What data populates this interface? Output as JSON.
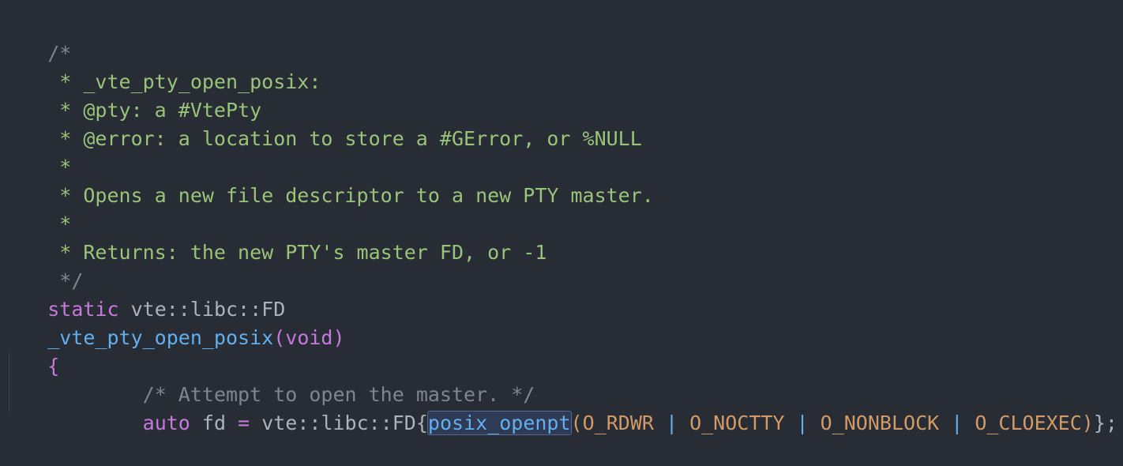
{
  "colors": {
    "background": "#282c34",
    "doc_comment": "#98c379",
    "dim_comment": "#7f848e",
    "keyword": "#c678dd",
    "function": "#61afef",
    "constant": "#d19a66",
    "plain": "#abb2bf",
    "selection": "#2f3b54"
  },
  "code": {
    "l1": {
      "a": "/*"
    },
    "l2": {
      "a": " * _vte_pty_open_posix:"
    },
    "l3": {
      "a": " * @pty: a #VtePty"
    },
    "l4": {
      "a": " * @error: a location to store a #GError, or %NULL"
    },
    "l5": {
      "a": " *"
    },
    "l6": {
      "a": " * Opens a new file descriptor to a new PTY master."
    },
    "l7": {
      "a": " *"
    },
    "l8": {
      "a": " * Returns: the new PTY's master FD, or -1"
    },
    "l9": {
      "a": " */"
    },
    "l10": {
      "kw": "static",
      "sp": " ",
      "type": "vte::libc::FD"
    },
    "l11": {
      "fn": "_vte_pty_open_posix",
      "lp": "(",
      "arg": "void",
      "rp": ")"
    },
    "l12": {
      "brace": "{"
    },
    "l13": {
      "indent": "        ",
      "comment": "/* Attempt to open the master. */"
    },
    "l14": {
      "indent": "        ",
      "kw": "auto",
      "var": " fd ",
      "eq": "=",
      "ns": " vte::libc::FD",
      "lb": "{",
      "call": "posix_openpt",
      "lp": "(",
      "c1": "O_RDWR",
      "p1": " | ",
      "c2": "O_NOCTTY",
      "p2": " | ",
      "c3": "O_NONBLOCK",
      "p3": " | ",
      "c4": "O_CLOEXEC",
      "rp": ")",
      "rb": "}",
      "semi": ";"
    }
  }
}
